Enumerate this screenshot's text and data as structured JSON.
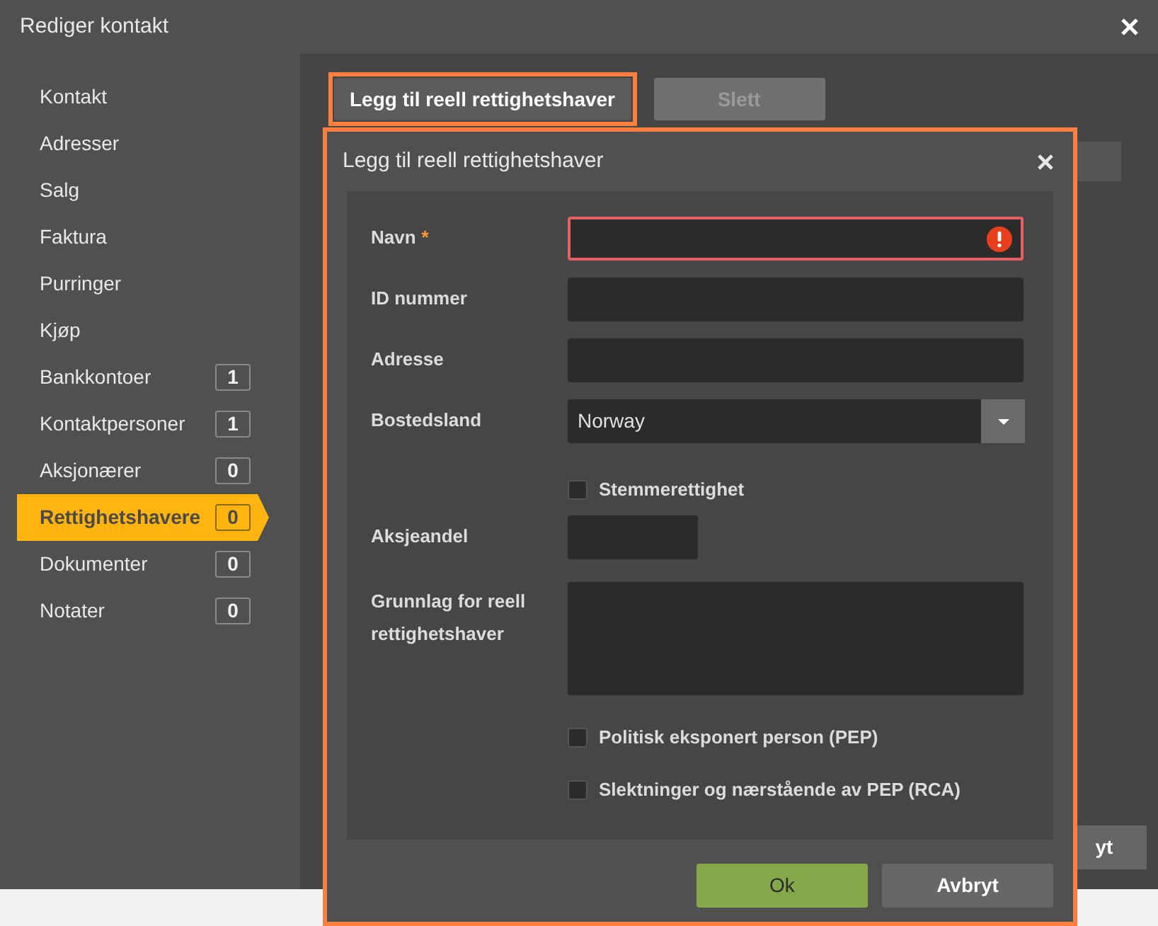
{
  "dialog": {
    "title": "Rediger kontakt"
  },
  "sidebar": {
    "items": [
      {
        "label": "Kontakt",
        "selected": false
      },
      {
        "label": "Adresser",
        "selected": false
      },
      {
        "label": "Salg",
        "selected": false
      },
      {
        "label": "Faktura",
        "selected": false
      },
      {
        "label": "Purringer",
        "selected": false
      },
      {
        "label": "Kjøp",
        "selected": false
      },
      {
        "label": "Bankkontoer",
        "count": "1",
        "selected": false
      },
      {
        "label": "Kontaktpersoner",
        "count": "1",
        "selected": false
      },
      {
        "label": "Aksjonærer",
        "count": "0",
        "selected": false
      },
      {
        "label": "Rettighetshavere",
        "count": "0",
        "selected": true
      },
      {
        "label": "Dokumenter",
        "count": "0",
        "selected": false
      },
      {
        "label": "Notater",
        "count": "0",
        "selected": false
      }
    ]
  },
  "toolbar": {
    "buttons": [
      {
        "label": "Legg til reell rettighetshaver",
        "disabled": false,
        "highlighted": true
      },
      {
        "label": "Slett",
        "disabled": true,
        "highlighted": false
      }
    ]
  },
  "footer": {
    "button": "yt"
  },
  "modal": {
    "title": "Legg til reell rettighetshaver",
    "fields": [
      {
        "kind": "text",
        "label": "Navn",
        "required_mark": "*",
        "error": true
      },
      {
        "kind": "text",
        "label": "ID nummer",
        "error": false
      },
      {
        "kind": "text",
        "label": "Adresse",
        "error": false
      },
      {
        "kind": "select",
        "label": "Bostedsland",
        "value": "Norway"
      },
      {
        "kind": "checkbox",
        "label": "Stemmerettighet",
        "checked": false
      },
      {
        "kind": "short",
        "label": "Aksjeandel",
        "error": false
      },
      {
        "kind": "textarea",
        "label": "Grunnlag for reell rettighetshaver"
      },
      {
        "kind": "checkbox",
        "label": "Politisk eksponert person (PEP)",
        "checked": false
      },
      {
        "kind": "checkbox",
        "label": "Slektninger og nærstående av PEP (RCA)",
        "checked": false
      }
    ],
    "buttons": [
      {
        "label": "Ok",
        "kind": "primary"
      },
      {
        "label": "Avbryt",
        "kind": "secondary"
      }
    ]
  }
}
